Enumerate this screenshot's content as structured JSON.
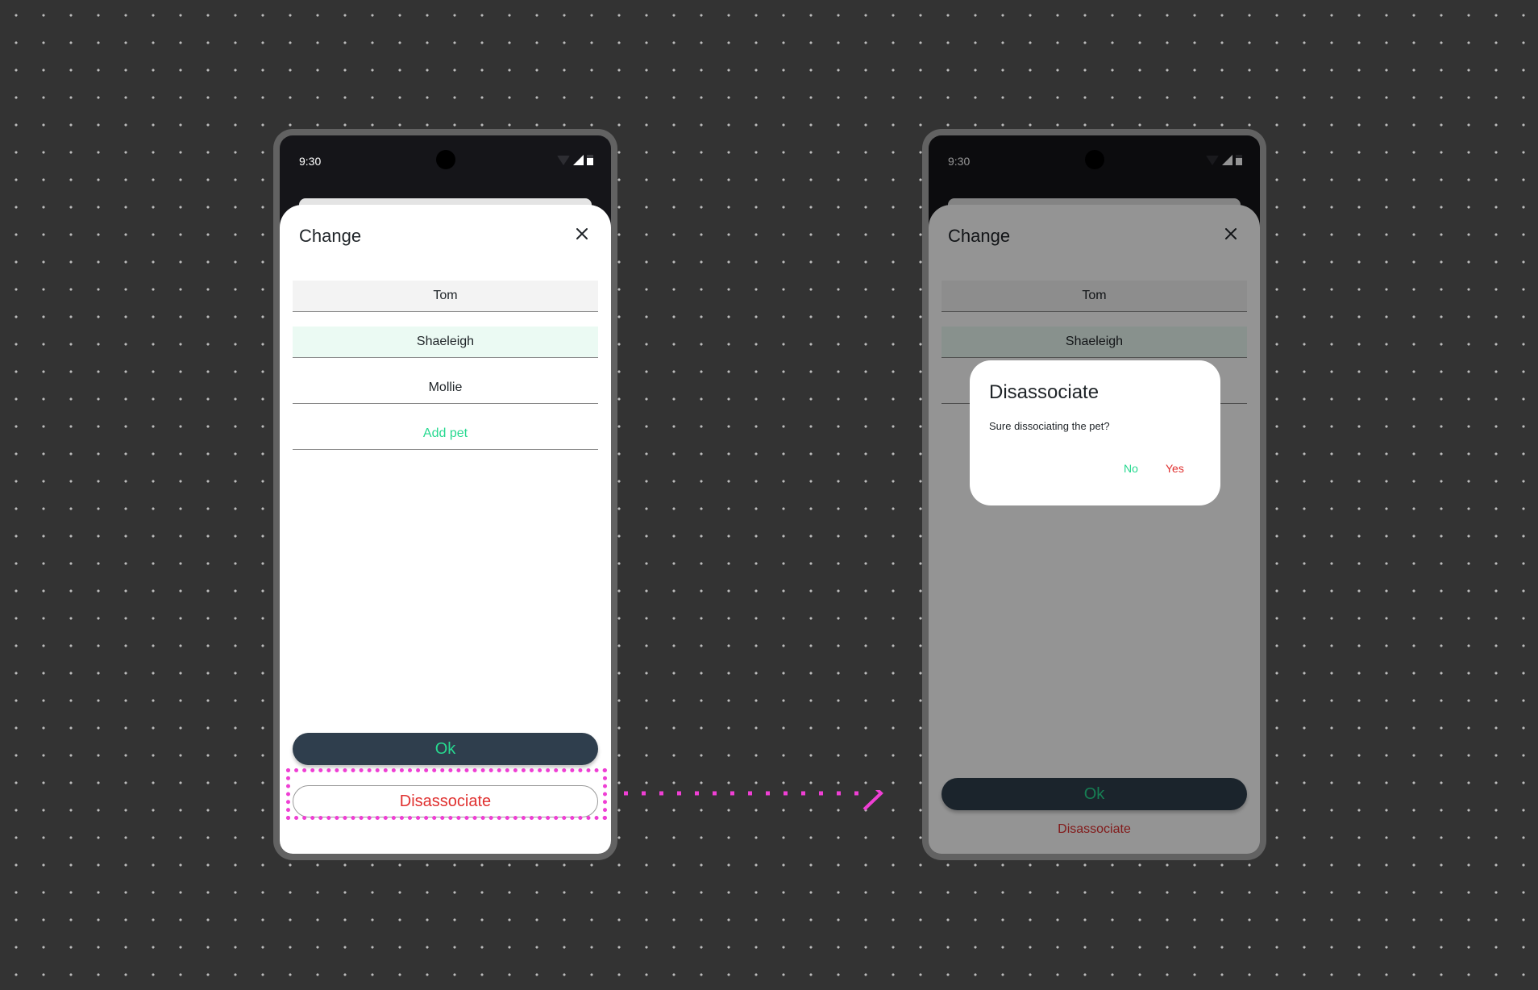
{
  "left_phone": {
    "status": {
      "time": "9:30"
    },
    "sheet": {
      "title": "Change",
      "pets": [
        "Tom",
        "Shaeleigh",
        "Mollie"
      ],
      "add_pet_label": "Add pet"
    },
    "ok_label": "Ok",
    "disassociate_label": "Disassociate"
  },
  "right_phone": {
    "status": {
      "time": "9:30"
    },
    "sheet": {
      "title": "Change",
      "pets": [
        "Tom",
        "Shaeleigh"
      ]
    },
    "ok_label": "Ok",
    "disassociate_label": "Disassociate",
    "dialog": {
      "title": "Disassociate",
      "message": "Sure dissociating the pet?",
      "no_label": "No",
      "yes_label": "Yes"
    }
  },
  "colors": {
    "background": "#333333",
    "accent_green": "#27d990",
    "danger_red": "#e0302f",
    "ok_button": "#2f3e4d",
    "annotation_magenta": "#ef3fd4"
  }
}
